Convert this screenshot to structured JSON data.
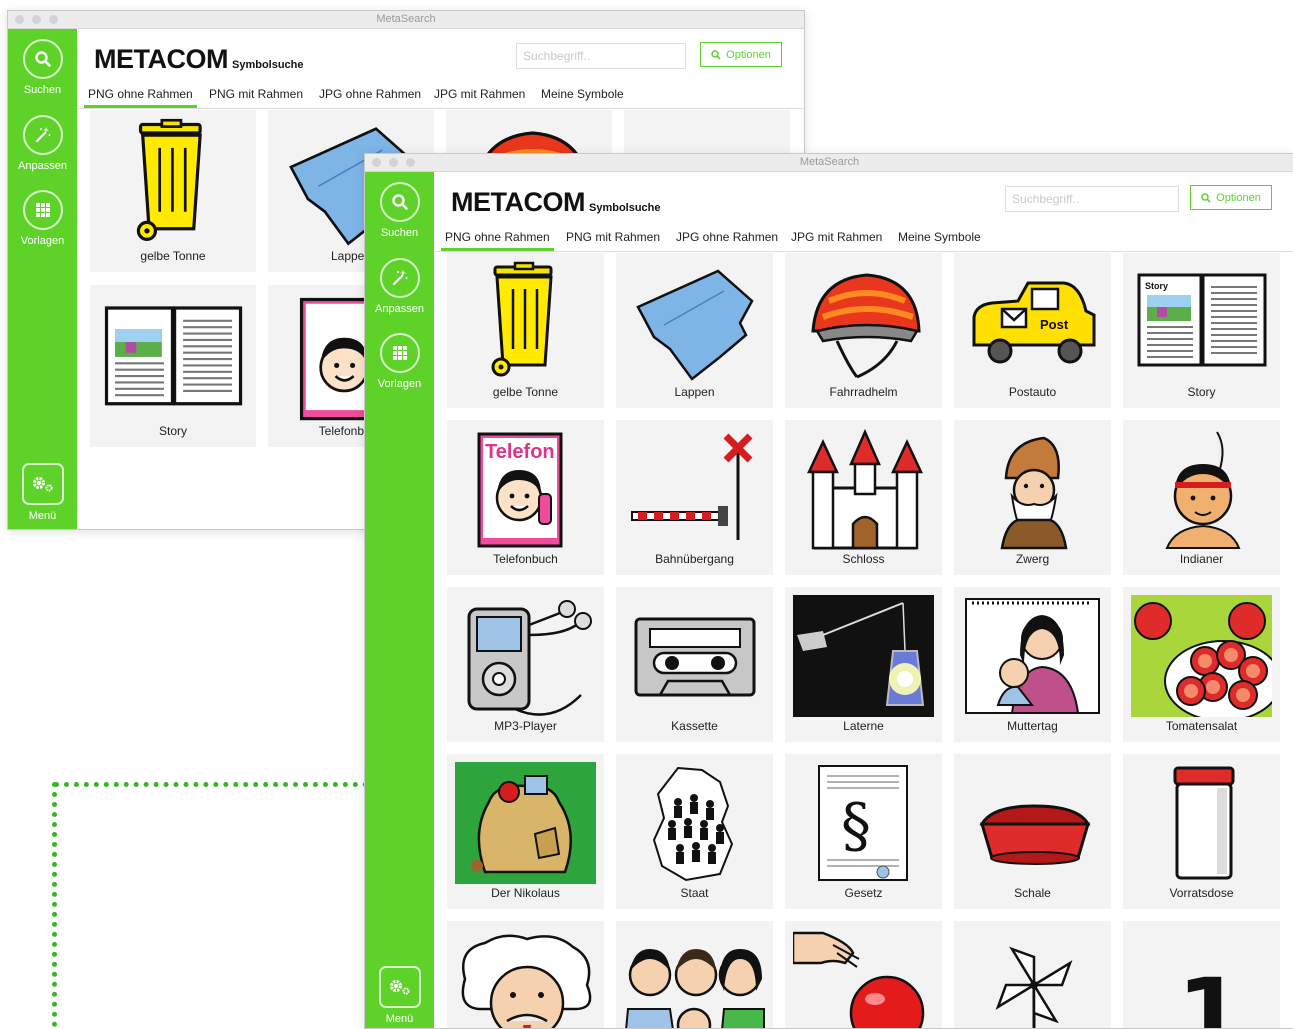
{
  "colors": {
    "accent": "#5fd22a",
    "sidebar": "#5fd22a",
    "dotted_line": "#37b524"
  },
  "app": {
    "window_title": "MetaSearch",
    "logo": "METACOM",
    "logo_subtitle": "Symbolsuche",
    "search_placeholder": "Suchbegriff..",
    "options_label": "Optionen"
  },
  "sidebar": {
    "items": [
      {
        "label": "Suchen",
        "icon": "search-icon"
      },
      {
        "label": "Anpassen",
        "icon": "magic-wand-icon"
      },
      {
        "label": "Vorlagen",
        "icon": "grid-icon"
      }
    ],
    "menu_label": "Menü",
    "menu_icon": "gears-icon"
  },
  "tabs": [
    "PNG ohne Rahmen",
    "PNG mit Rahmen",
    "JPG ohne Rahmen",
    "JPG mit Rahmen",
    "Meine Symbole"
  ],
  "active_tab": "PNG ohne Rahmen",
  "back_window": {
    "symbols": [
      {
        "label": "gelbe Tonne",
        "icon": "yellow-bin-icon"
      },
      {
        "label": "Lappen",
        "icon": "cloth-icon"
      },
      {
        "label": "",
        "icon": "bicycle-helmet-icon"
      },
      {
        "label": "",
        "icon": ""
      },
      {
        "label": "Story",
        "icon": "storybook-icon"
      },
      {
        "label": "Telefonbuch",
        "icon": "phonebook-icon"
      },
      {
        "label": "",
        "icon": "gnome-icon"
      },
      {
        "label": "",
        "icon": "indian-icon"
      }
    ]
  },
  "front_window": {
    "symbols": [
      {
        "label": "gelbe Tonne",
        "icon": "yellow-bin-icon"
      },
      {
        "label": "Lappen",
        "icon": "cloth-icon"
      },
      {
        "label": "Fahrradhelm",
        "icon": "bicycle-helmet-icon"
      },
      {
        "label": "Postauto",
        "icon": "post-car-icon",
        "text": "Post"
      },
      {
        "label": "Story",
        "icon": "storybook-icon",
        "text": "Story"
      },
      {
        "label": "Telefonbuch",
        "icon": "phonebook-icon",
        "text": "Telefon"
      },
      {
        "label": "Bahnübergang",
        "icon": "railroad-crossing-icon"
      },
      {
        "label": "Schloss",
        "icon": "castle-icon"
      },
      {
        "label": "Zwerg",
        "icon": "gnome-icon"
      },
      {
        "label": "Indianer",
        "icon": "indian-icon"
      },
      {
        "label": "MP3-Player",
        "icon": "mp3-player-icon"
      },
      {
        "label": "Kassette",
        "icon": "cassette-icon"
      },
      {
        "label": "Laterne",
        "icon": "lantern-icon"
      },
      {
        "label": "Muttertag",
        "icon": "mothers-day-icon"
      },
      {
        "label": "Tomatensalat",
        "icon": "tomato-salad-icon"
      },
      {
        "label": "Der Nikolaus",
        "icon": "nikolaus-sack-icon"
      },
      {
        "label": "Staat",
        "icon": "state-map-icon"
      },
      {
        "label": "Gesetz",
        "icon": "law-paragraph-icon",
        "text": "§"
      },
      {
        "label": "Schale",
        "icon": "bowl-icon"
      },
      {
        "label": "Vorratsdose",
        "icon": "storage-jar-icon"
      },
      {
        "label": "",
        "icon": "einstein-face-icon"
      },
      {
        "label": "",
        "icon": "family-icon"
      },
      {
        "label": "",
        "icon": "hand-ball-icon"
      },
      {
        "label": "",
        "icon": "pinwheel-icon"
      },
      {
        "label": "",
        "icon": "number-one-icon",
        "text": "1"
      }
    ]
  }
}
